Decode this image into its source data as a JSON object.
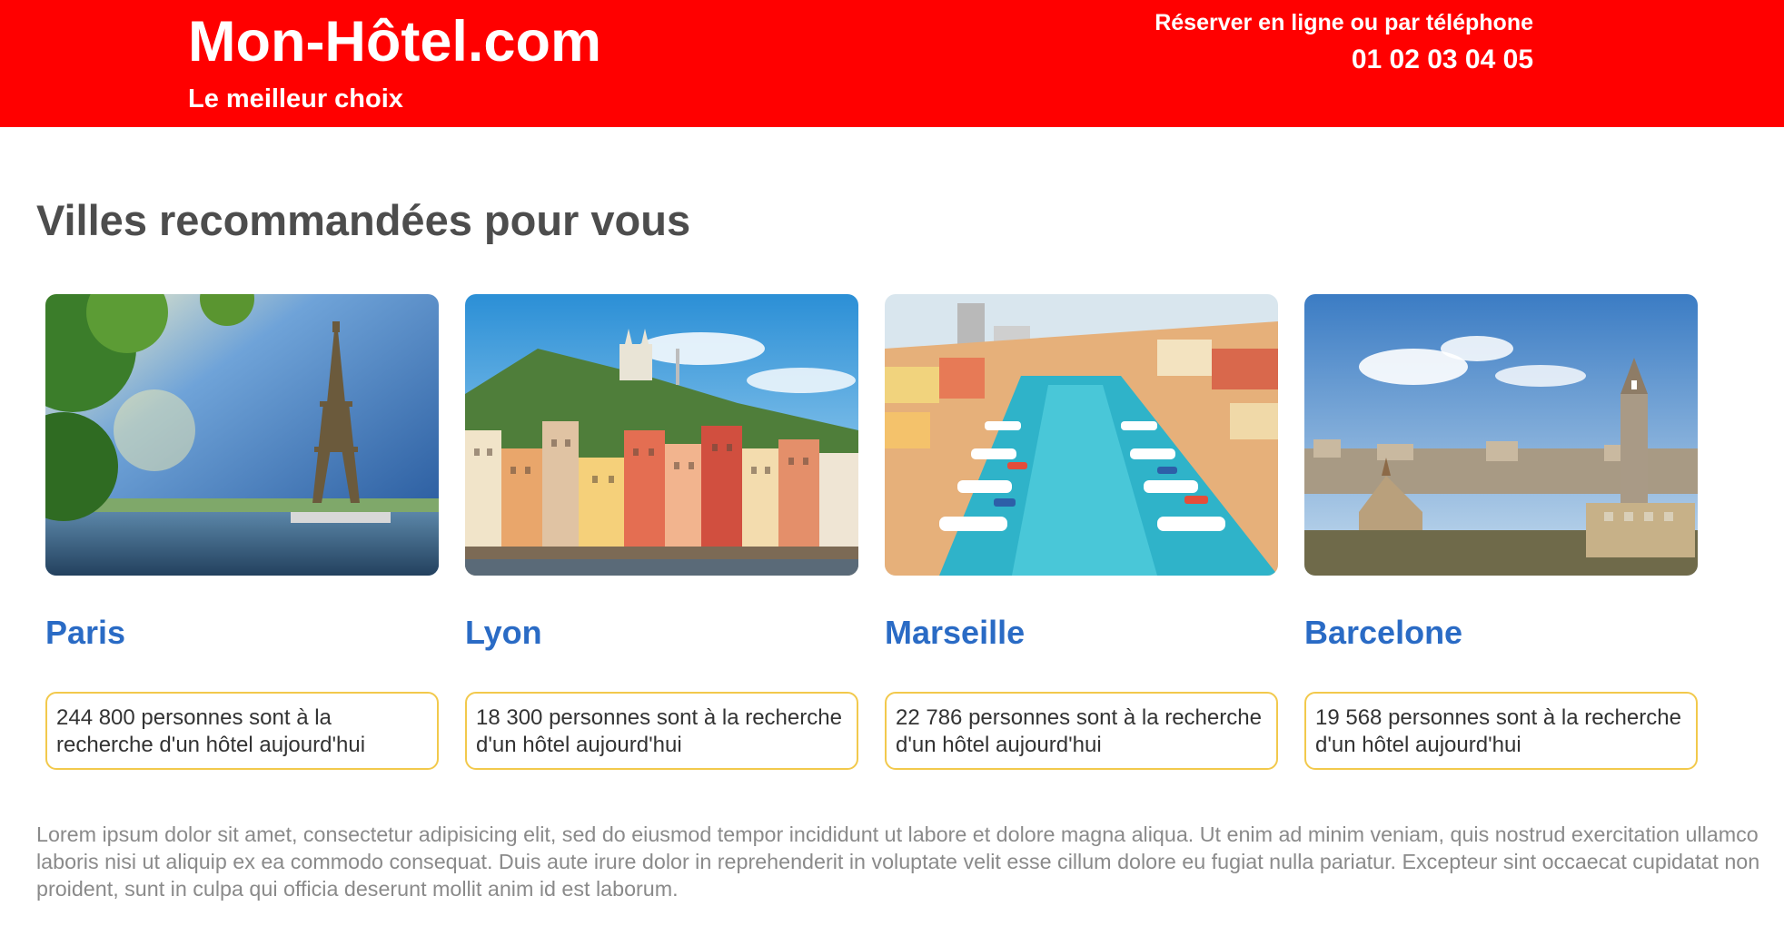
{
  "header": {
    "brand": "Mon-Hôtel.com",
    "tagline": "Le meilleur choix",
    "booking_text": "Réserver en ligne ou par téléphone",
    "phone": "01 02 03 04 05",
    "background_color": "#ff0000"
  },
  "main": {
    "title": "Villes recommandées pour vous",
    "cities": [
      {
        "name": "Paris",
        "stat": "244 800 personnes sont à la recherche d'un hôtel aujourd'hui",
        "image": "eiffel-tower-photo"
      },
      {
        "name": "Lyon",
        "stat": "18 300 personnes sont à la recherche d'un hôtel aujourd'hui",
        "image": "lyon-riverside-photo"
      },
      {
        "name": "Marseille",
        "stat": "22 786 personnes sont à la recherche d'un hôtel aujourd'hui",
        "image": "marseille-harbor-photo"
      },
      {
        "name": "Barcelone",
        "stat": "19 568 personnes sont à la recherche d'un hôtel aujourd'hui",
        "image": "barcelona-park-guell-photo"
      }
    ],
    "description": "Lorem ipsum dolor sit amet, consectetur adipisicing elit, sed do eiusmod tempor incididunt ut labore et dolore magna aliqua. Ut enim ad minim veniam, quis nostrud exercitation ullamco laboris nisi ut aliquip ex ea commodo consequat. Duis aute irure dolor in reprehenderit in voluptate velit esse cillum dolore eu fugiat nulla pariatur. Excepteur sint occaecat cupidatat non proident, sunt in culpa qui officia deserunt mollit anim id est laborum."
  },
  "colors": {
    "accent_red": "#ff0000",
    "city_link_blue": "#2a6bc5",
    "stat_border_yellow": "#f2c94c",
    "title_gray": "#4d4d4d",
    "body_gray": "#8a8a8a"
  }
}
